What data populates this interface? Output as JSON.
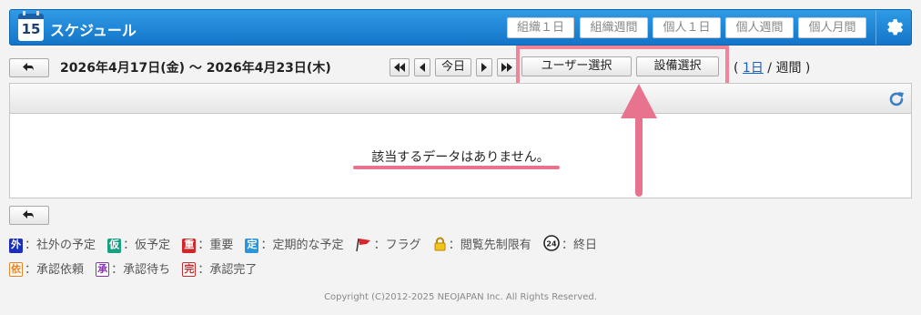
{
  "header": {
    "day_number": "15",
    "title": "スケジュール",
    "view_buttons": [
      "組織１日",
      "組織週間",
      "個人１日",
      "個人週間",
      "個人月間"
    ]
  },
  "toolbar": {
    "date_range": "2026年4月17日(金) ～ 2026年4月23日(木)",
    "today_label": "今日",
    "user_select_label": "ユーザー選択",
    "facility_select_label": "設備選択",
    "period_open": "(",
    "period_day_link": "1日",
    "period_sep": " / ",
    "period_week": "週間",
    "period_close": ")"
  },
  "panel": {
    "empty_message": "該当するデータはありません。"
  },
  "legend": {
    "row1": [
      {
        "badge": "外",
        "label": "：社外の予定"
      },
      {
        "badge": "仮",
        "label": "：仮予定"
      },
      {
        "badge": "重",
        "label": "：重要"
      },
      {
        "badge": "定",
        "label": "：定期的な予定"
      },
      {
        "icon": "flag-icon",
        "label": "：フラグ"
      },
      {
        "icon": "lock-icon",
        "label": "：閲覧先制限有"
      },
      {
        "icon": "allday-24-icon",
        "badge": "24",
        "label": "：終日"
      }
    ],
    "row2": [
      {
        "badge": "依",
        "label": "：承認依頼"
      },
      {
        "badge": "承",
        "label": "：承認待ち"
      },
      {
        "badge": "完",
        "label": "：承認完了"
      }
    ]
  },
  "footer": {
    "copyright": "Copyright (C)2012-2025 NEOJAPAN Inc. All Rights Reserved."
  },
  "colors": {
    "header_blue": "#1475c8",
    "annotation_pink": "#ef8597",
    "link_blue": "#1a5fc2"
  }
}
